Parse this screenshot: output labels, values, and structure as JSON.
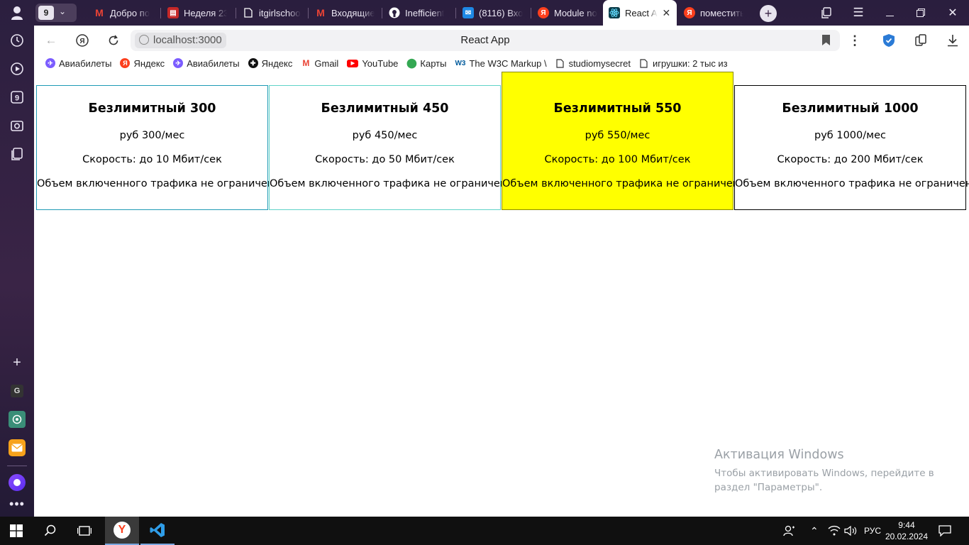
{
  "tabs": {
    "count_badge": "9",
    "items": [
      {
        "label": "Добро по",
        "icon": "gmail-icon",
        "color": "#ea4335"
      },
      {
        "label": "Неделя 23",
        "icon": "document-icon",
        "color": "#c62828"
      },
      {
        "label": "itgirlschoo",
        "icon": "page-icon",
        "color": "#ffffff"
      },
      {
        "label": "Входящие",
        "icon": "gmail-icon",
        "color": "#ea4335"
      },
      {
        "label": "Inefficient",
        "icon": "github-icon",
        "color": "#ffffff"
      },
      {
        "label": "(8116) Вхо",
        "icon": "mail-icon",
        "color": "#1e88e5"
      },
      {
        "label": "Module no",
        "icon": "yandex-icon",
        "color": "#fc3f1d"
      },
      {
        "label": "React A",
        "icon": "react-icon",
        "color": "#0b7285"
      },
      {
        "label": "поместить",
        "icon": "yandex-icon",
        "color": "#fc3f1d"
      }
    ]
  },
  "address_bar": {
    "url": "localhost:3000",
    "page_title": "React App"
  },
  "bookmarks": [
    {
      "label": "Авиабилеты",
      "icon": "aviasales-icon",
      "color": "#7b5cff"
    },
    {
      "label": "Яндекс",
      "icon": "yandex-icon",
      "color": "#fc3f1d"
    },
    {
      "label": "Авиабилеты",
      "icon": "aviasales-icon",
      "color": "#7b5cff"
    },
    {
      "label": "Яндекс",
      "icon": "yandex-alt-icon",
      "color": "#111111"
    },
    {
      "label": "Gmail",
      "icon": "gmail-icon",
      "color": "#ea4335"
    },
    {
      "label": "YouTube",
      "icon": "youtube-icon",
      "color": "#ff0000"
    },
    {
      "label": "Карты",
      "icon": "maps-icon",
      "color": "#34a853"
    },
    {
      "label": "The W3C Markup \\",
      "icon": "w3c-icon",
      "color": "#005a9c"
    },
    {
      "label": "studiomysecret",
      "icon": "page-icon",
      "color": "#333333"
    },
    {
      "label": "игрушки: 2 тыс из",
      "icon": "page-icon",
      "color": "#333333"
    }
  ],
  "plans": [
    {
      "title": "Безлимитный 300",
      "price": "руб 300/мес",
      "speed": "Скорость: до 10 Мбит/сек",
      "traffic": "Объем включенного трафика не ограничен",
      "border": "#1f9bb5",
      "background": "#ffffff"
    },
    {
      "title": "Безлимитный 450",
      "price": "руб 450/мес",
      "speed": "Скорость: до 50 Мбит/сек",
      "traffic": "Объем включенного трафика не ограничен",
      "border": "#5fd3c8",
      "background": "#ffffff"
    },
    {
      "title": "Безлимитный 550",
      "price": "руб 550/мес",
      "speed": "Скорость: до 100 Мбит/сек",
      "traffic": "Объем включенного трафика не ограничен",
      "border": "#8a8a00",
      "background": "#ffff00"
    },
    {
      "title": "Безлимитный 1000",
      "price": "руб 1000/мес",
      "speed": "Скорость: до 200 Мбит/сек",
      "traffic": "Объем включенного трафика не ограничен",
      "border": "#000000",
      "background": "#ffffff"
    }
  ],
  "watermark": {
    "title": "Активация Windows",
    "text": "Чтобы активировать Windows, перейдите в раздел \"Параметры\"."
  },
  "taskbar": {
    "language": "РУС",
    "time": "9:44",
    "date": "20.02.2024"
  }
}
